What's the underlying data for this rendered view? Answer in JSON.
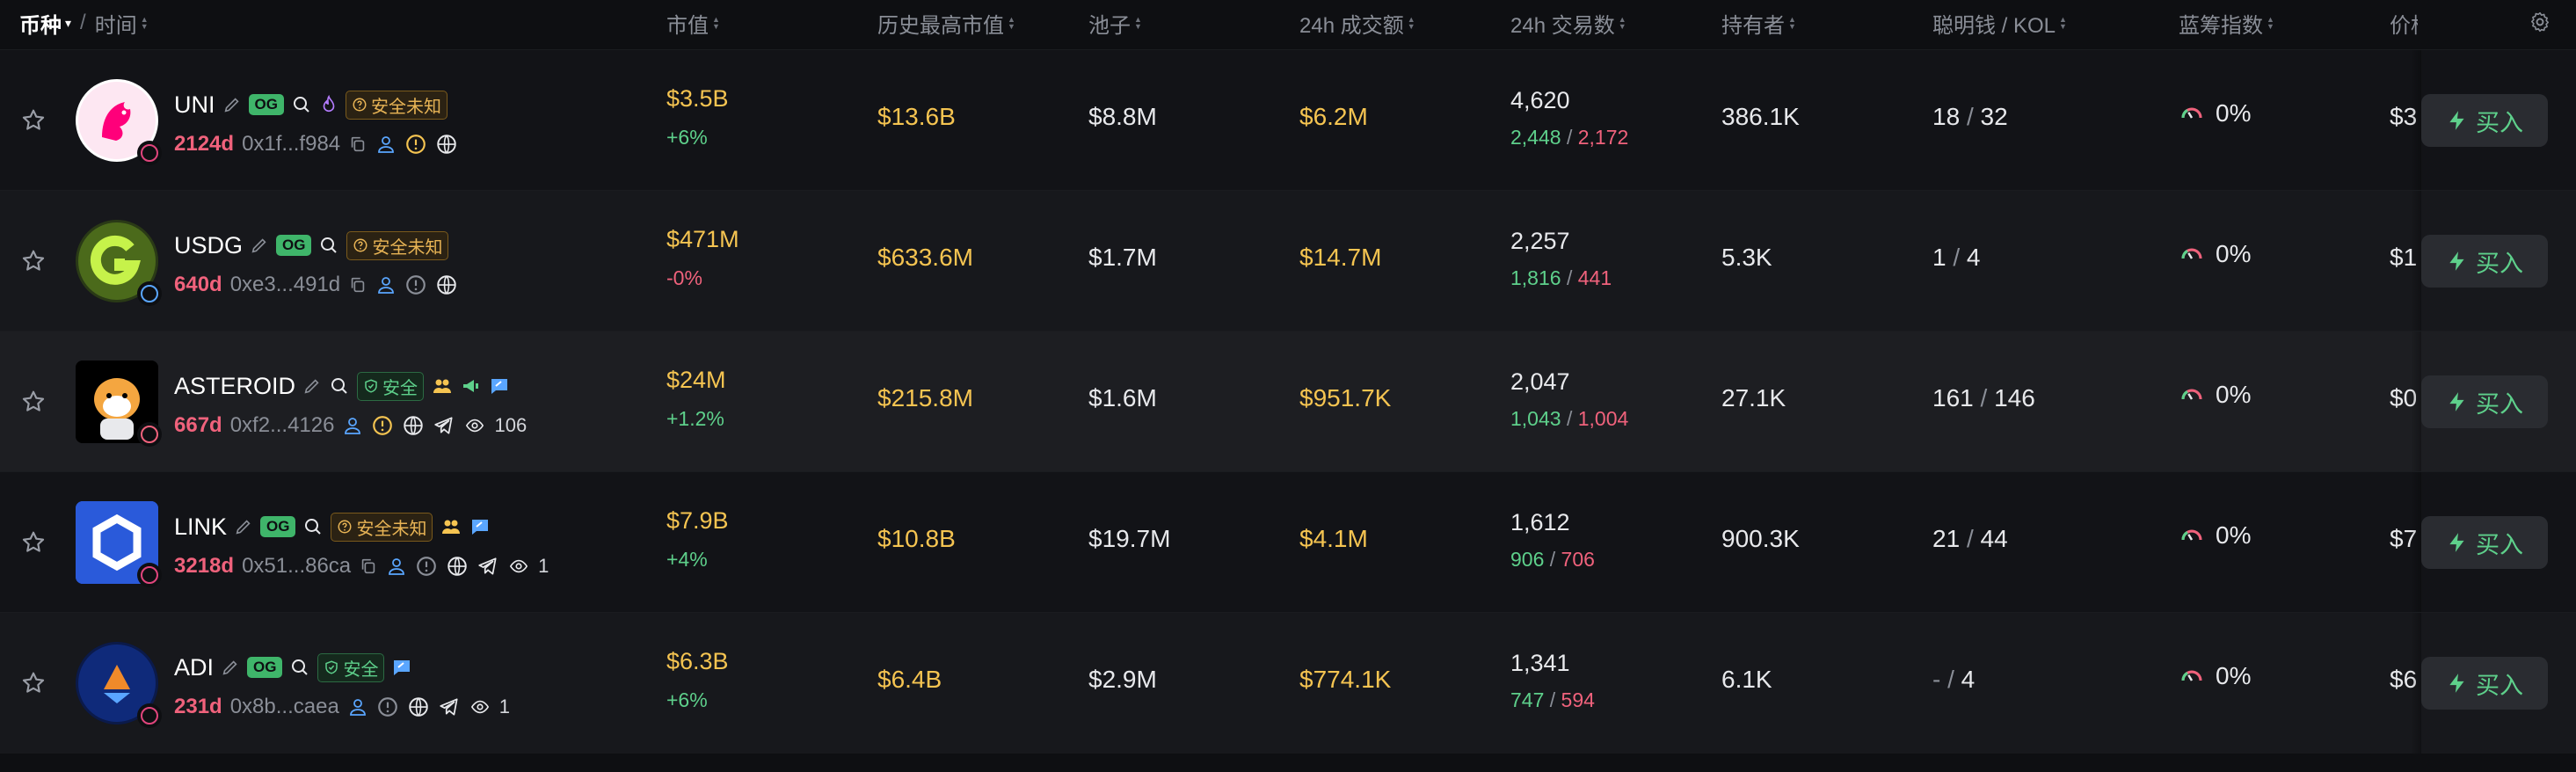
{
  "header": {
    "coin": "币种",
    "time": "时间",
    "market_cap": "市值",
    "ath_market_cap": "历史最高市值",
    "pool": "池子",
    "volume_24h": "24h 成交额",
    "tx_24h": "24h 交易数",
    "holders": "持有者",
    "smart_money": "聪明钱 / KOL",
    "bluechip": "蓝筹指数",
    "price": "价格"
  },
  "colors": {
    "accent_yellow": "#f5c451",
    "up_green": "#5ed08b",
    "down_red": "#f0627c"
  },
  "rows": [
    {
      "symbol": "UNI",
      "og": "OG",
      "safety": "安全未知",
      "safety_level": "unknown",
      "age": "2124d",
      "address": "0x1f...f984",
      "views": "",
      "market_cap": "$3.5B",
      "mc_change": "+6%",
      "mc_dir": "up",
      "ath": "$13.6B",
      "pool": "$8.8M",
      "volume": "$6.2M",
      "tx_total": "4,620",
      "tx_buy": "2,448",
      "tx_sell": "2,172",
      "holders": "386.1K",
      "smart": "18",
      "kol": "32",
      "bluechip": "0%",
      "price": "$3",
      "buy": "买入"
    },
    {
      "symbol": "USDG",
      "og": "OG",
      "safety": "安全未知",
      "safety_level": "unknown",
      "age": "640d",
      "address": "0xe3...491d",
      "views": "",
      "market_cap": "$471M",
      "mc_change": "-0%",
      "mc_dir": "down",
      "ath": "$633.6M",
      "pool": "$1.7M",
      "volume": "$14.7M",
      "tx_total": "2,257",
      "tx_buy": "1,816",
      "tx_sell": "441",
      "holders": "5.3K",
      "smart": "1",
      "kol": "4",
      "bluechip": "0%",
      "price": "$1",
      "buy": "买入"
    },
    {
      "symbol": "ASTEROID",
      "og": "",
      "safety": "安全",
      "safety_level": "safe",
      "age": "667d",
      "address": "0xf2...4126",
      "views": "106",
      "market_cap": "$24M",
      "mc_change": "+1.2%",
      "mc_dir": "up",
      "ath": "$215.8M",
      "pool": "$1.6M",
      "volume": "$951.7K",
      "tx_total": "2,047",
      "tx_buy": "1,043",
      "tx_sell": "1,004",
      "holders": "27.1K",
      "smart": "161",
      "kol": "146",
      "bluechip": "0%",
      "price": "$0",
      "buy": "买入"
    },
    {
      "symbol": "LINK",
      "og": "OG",
      "safety": "安全未知",
      "safety_level": "unknown",
      "age": "3218d",
      "address": "0x51...86ca",
      "views": "1",
      "market_cap": "$7.9B",
      "mc_change": "+4%",
      "mc_dir": "up",
      "ath": "$10.8B",
      "pool": "$19.7M",
      "volume": "$4.1M",
      "tx_total": "1,612",
      "tx_buy": "906",
      "tx_sell": "706",
      "holders": "900.3K",
      "smart": "21",
      "kol": "44",
      "bluechip": "0%",
      "price": "$7",
      "buy": "买入"
    },
    {
      "symbol": "ADI",
      "og": "OG",
      "safety": "安全",
      "safety_level": "safe",
      "age": "231d",
      "address": "0x8b...caea",
      "views": "1",
      "market_cap": "$6.3B",
      "mc_change": "+6%",
      "mc_dir": "up",
      "ath": "$6.4B",
      "pool": "$2.9M",
      "volume": "$774.1K",
      "tx_total": "1,341",
      "tx_buy": "747",
      "tx_sell": "594",
      "holders": "6.1K",
      "smart": "-",
      "kol": "4",
      "bluechip": "0%",
      "price": "$6",
      "buy": "买入"
    }
  ]
}
